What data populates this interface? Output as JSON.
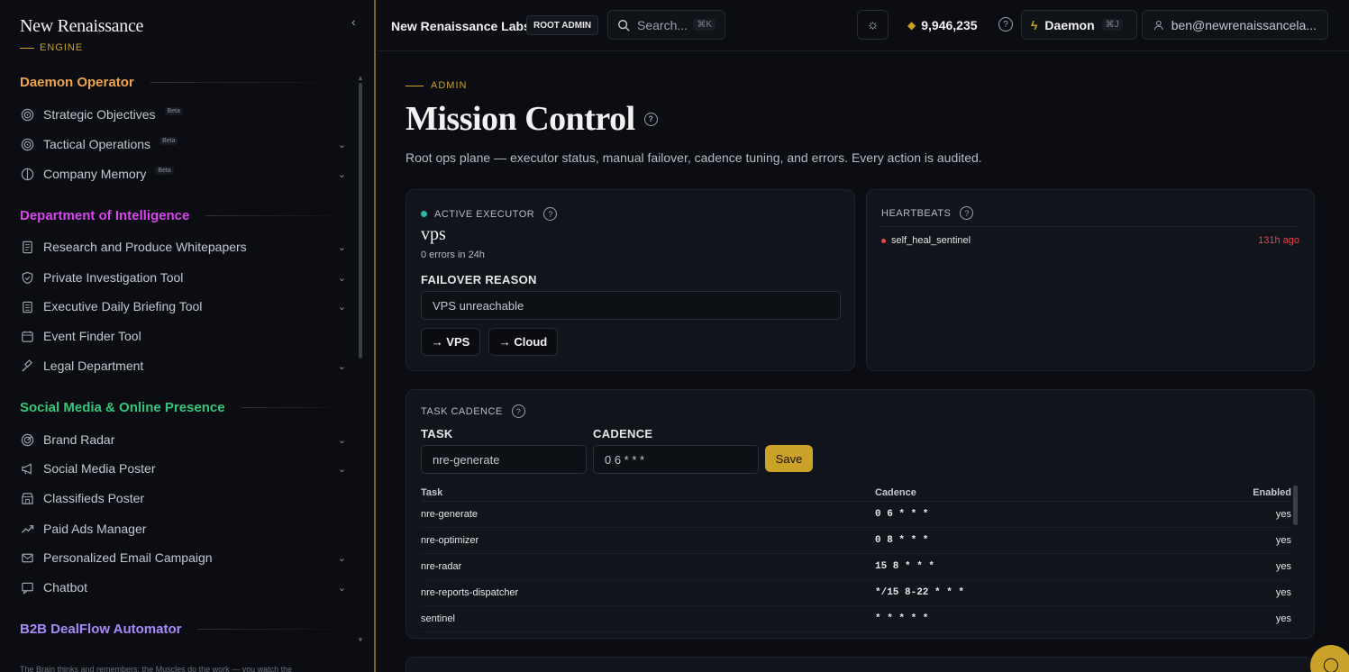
{
  "brand": {
    "name": "New Renaissance",
    "sub": "ENGINE"
  },
  "sidebar": {
    "sections": [
      {
        "title": "Daemon Operator",
        "color": "#f0a44b",
        "items": [
          {
            "label": "Strategic Objectives",
            "icon": "target-icon",
            "beta": "Beta",
            "chevron": false
          },
          {
            "label": "Tactical Operations",
            "icon": "target-icon",
            "beta": "Beta",
            "chevron": true
          },
          {
            "label": "Company Memory",
            "icon": "brain-icon",
            "beta": "Beta",
            "chevron": true
          }
        ]
      },
      {
        "title": "Department of Intelligence",
        "color": "#d946ef",
        "items": [
          {
            "label": "Research and Produce Whitepapers",
            "icon": "document-icon",
            "chevron": true
          },
          {
            "label": "Private Investigation Tool",
            "icon": "shield-icon",
            "chevron": true
          },
          {
            "label": "Executive Daily Briefing Tool",
            "icon": "clipboard-icon",
            "chevron": true
          },
          {
            "label": "Event Finder Tool",
            "icon": "calendar-icon",
            "chevron": false
          },
          {
            "label": "Legal Department",
            "icon": "gavel-icon",
            "chevron": true
          }
        ]
      },
      {
        "title": "Social Media & Online Presence",
        "color": "#34c77b",
        "items": [
          {
            "label": "Brand Radar",
            "icon": "radar-icon",
            "chevron": true
          },
          {
            "label": "Social Media Poster",
            "icon": "megaphone-icon",
            "chevron": true
          },
          {
            "label": "Classifieds Poster",
            "icon": "store-icon",
            "chevron": false
          },
          {
            "label": "Paid Ads Manager",
            "icon": "trending-up-icon",
            "chevron": false
          },
          {
            "label": "Personalized Email Campaign",
            "icon": "mail-icon",
            "chevron": true
          },
          {
            "label": "Chatbot",
            "icon": "chat-icon",
            "chevron": true
          }
        ]
      },
      {
        "title": "B2B DealFlow Automator",
        "color": "#a78bfa",
        "items": []
      }
    ],
    "footer": "The Brain thinks and remembers; the Muscles do the work — you watch the"
  },
  "topbar": {
    "org": "New Renaissance Labs",
    "badge": "ROOT ADMIN",
    "search_placeholder": "Search...",
    "search_kbd": "⌘K",
    "credits": "9,946,235",
    "daemon_label": "Daemon",
    "daemon_kbd": "⌘J",
    "user_email": "ben@newrenaissancela..."
  },
  "main": {
    "eyebrow": "ADMIN",
    "title": "Mission Control",
    "subtitle": "Root ops plane — executor status, manual failover, cadence tuning, and errors. Every action is audited."
  },
  "executor": {
    "label": "ACTIVE EXECUTOR",
    "name": "vps",
    "errors": "0 errors in 24h",
    "failover_label": "FAILOVER REASON",
    "failover_value": "VPS unreachable",
    "btn_vps": "→ VPS",
    "btn_cloud": "→ Cloud",
    "status_color": "#2bb5a0"
  },
  "heartbeats": {
    "label": "HEARTBEATS",
    "rows": [
      {
        "name": "self_heal_sentinel",
        "ago": "131h ago"
      }
    ]
  },
  "cadence": {
    "label": "TASK CADENCE",
    "task_label": "TASK",
    "task_value": "nre-generate",
    "cadence_label": "CADENCE",
    "cadence_value": "0 6 * * *",
    "save": "Save",
    "columns": [
      "Task",
      "Cadence",
      "Enabled"
    ],
    "rows": [
      {
        "task": "nre-generate",
        "cadence": "0 6 * * *",
        "enabled": "yes"
      },
      {
        "task": "nre-optimizer",
        "cadence": "0 8 * * *",
        "enabled": "yes"
      },
      {
        "task": "nre-radar",
        "cadence": "15 8 * * *",
        "enabled": "yes"
      },
      {
        "task": "nre-reports-dispatcher",
        "cadence": "*/15 8-22 * * *",
        "enabled": "yes"
      },
      {
        "task": "sentinel",
        "cadence": "* * * * *",
        "enabled": "yes"
      }
    ]
  },
  "colors": {
    "accent": "#c9a227",
    "error": "#e5484d"
  }
}
